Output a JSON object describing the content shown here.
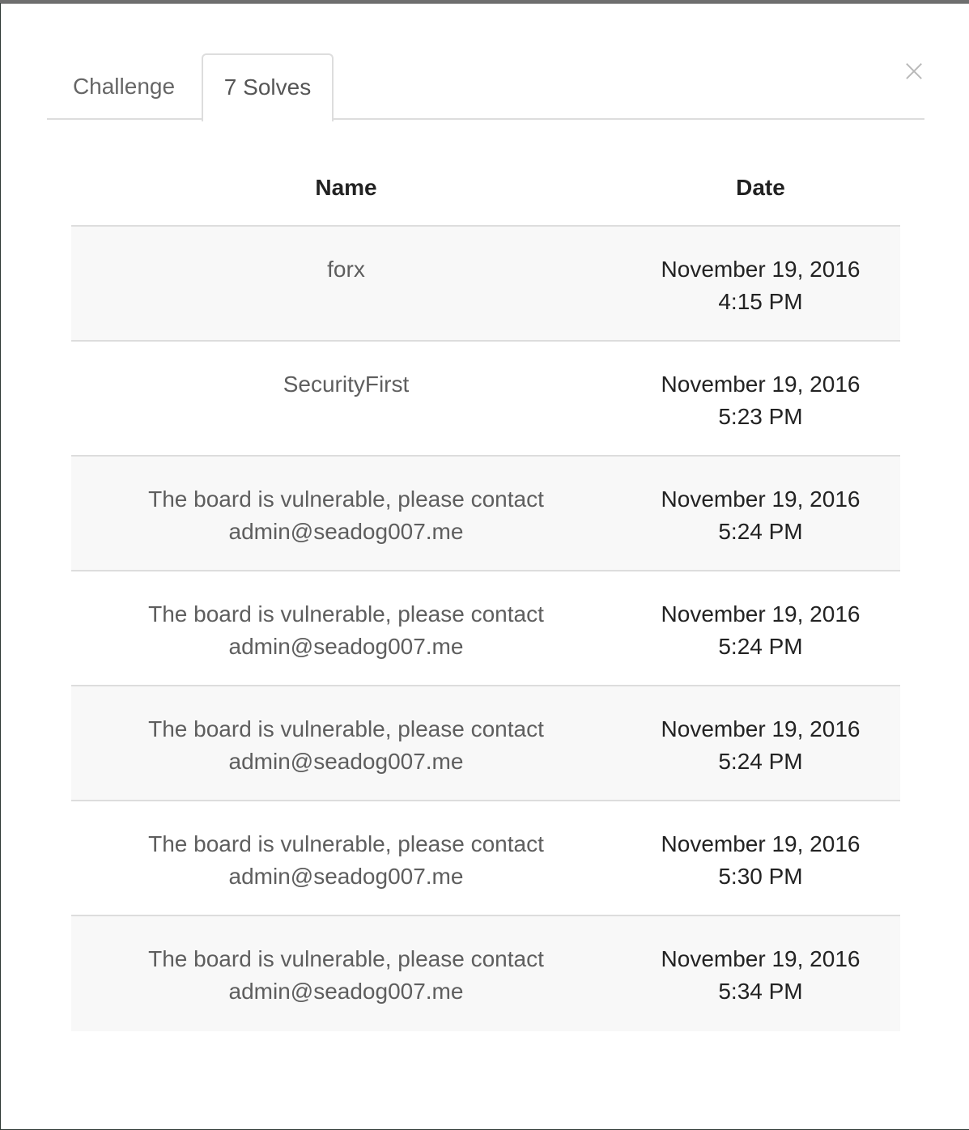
{
  "tabs": [
    {
      "label": "Challenge",
      "active": false
    },
    {
      "label": "7 Solves",
      "active": true
    }
  ],
  "close_icon": "×",
  "table": {
    "headers": {
      "name": "Name",
      "date": "Date"
    },
    "rows": [
      {
        "name_line1": "forx",
        "name_line2": "",
        "date": "November 19, 2016",
        "time": "4:15 PM"
      },
      {
        "name_line1": "SecurityFirst",
        "name_line2": "",
        "date": "November 19, 2016",
        "time": "5:23 PM"
      },
      {
        "name_line1": "The board is vulnerable, please contact",
        "name_line2": "admin@seadog007.me",
        "date": "November 19, 2016",
        "time": "5:24 PM"
      },
      {
        "name_line1": "The board is vulnerable, please contact",
        "name_line2": "admin@seadog007.me",
        "date": "November 19, 2016",
        "time": "5:24 PM"
      },
      {
        "name_line1": "The board is vulnerable, please contact",
        "name_line2": "admin@seadog007.me",
        "date": "November 19, 2016",
        "time": "5:24 PM"
      },
      {
        "name_line1": "The board is vulnerable, please contact",
        "name_line2": "admin@seadog007.me",
        "date": "November 19, 2016",
        "time": "5:30 PM"
      },
      {
        "name_line1": "The board is vulnerable, please contact",
        "name_line2": "admin@seadog007.me",
        "date": "November 19, 2016",
        "time": "5:34 PM"
      }
    ]
  },
  "colors": {
    "stripe": "#f8f8f8",
    "border": "#dddddd",
    "name_text": "#5e5e5e",
    "date_text": "#222222"
  }
}
